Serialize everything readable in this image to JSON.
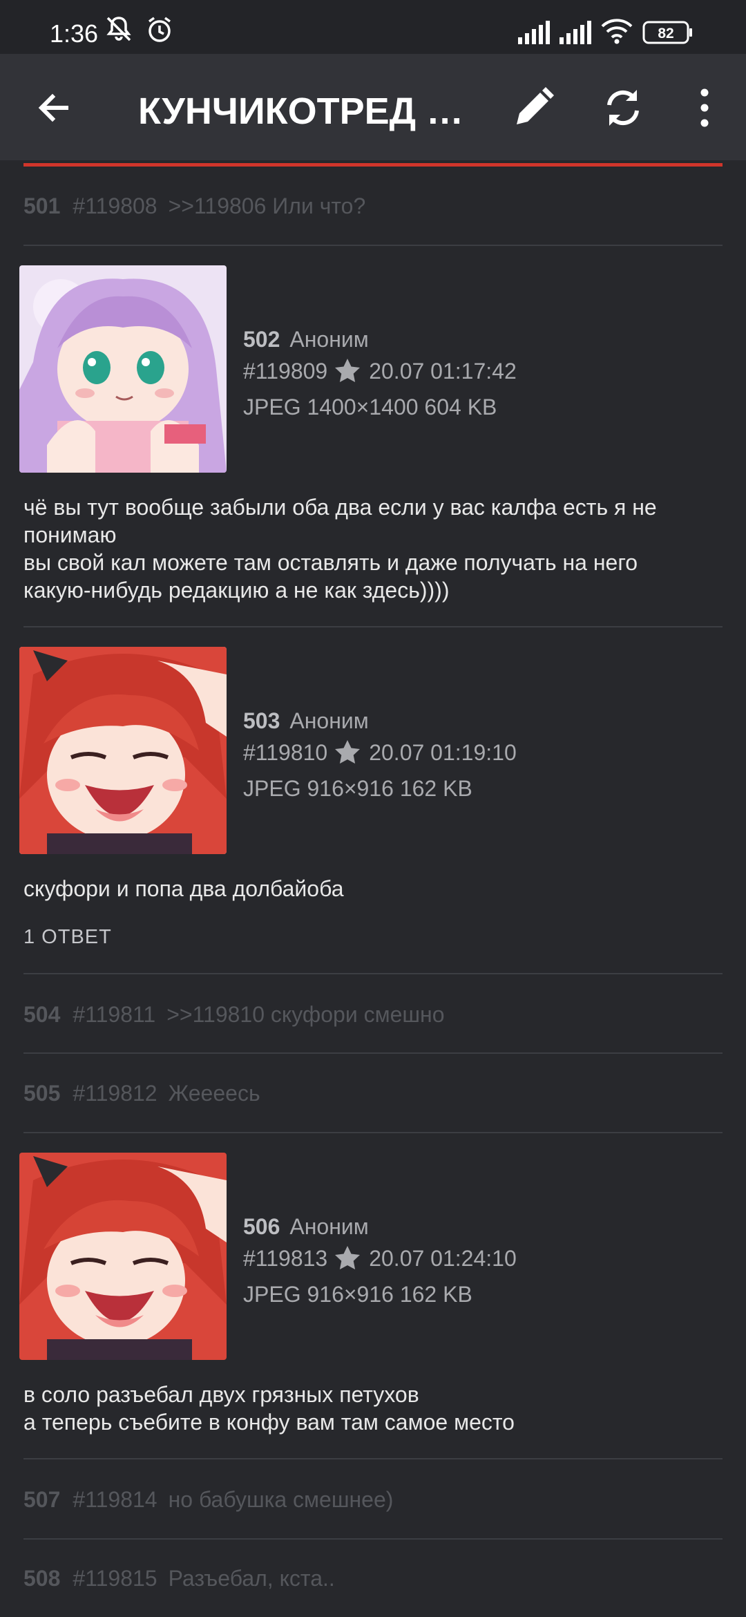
{
  "status_bar": {
    "time": "1:36",
    "battery": "82"
  },
  "toolbar": {
    "title": "КУНЧИКОТРЕД №…",
    "back_icon": "arrow-left",
    "edit_icon": "pencil",
    "refresh_icon": "refresh",
    "menu_icon": "dots-vertical"
  },
  "colors": {
    "background": "#27282c",
    "toolbar": "#323338",
    "accent": "#d0352b"
  },
  "posts": [
    {
      "num": "501",
      "id": "#119808",
      "preview": ">>119806 Или что?"
    },
    {
      "num": "502",
      "author": "Аноним",
      "id": "#119809",
      "date": "20.07 01:17:42",
      "file": "JPEG 1400×1400 604 KB",
      "text_lines": [
        "чё вы тут вообще забыли оба два если у вас калфа есть я не",
        "понимаю",
        "вы свой кал можете там оставлять и даже получать на него",
        "какую-нибудь редакцию а не как здесь))))"
      ]
    },
    {
      "num": "503",
      "author": "Аноним",
      "id": "#119810",
      "date": "20.07 01:19:10",
      "file": "JPEG 916×916 162 KB",
      "text_lines": [
        "скуфори и попа два долбайоба"
      ],
      "replies": "1 ОТВЕТ"
    },
    {
      "num": "504",
      "id": "#119811",
      "preview": ">>119810 скуфори смешно"
    },
    {
      "num": "505",
      "id": "#119812",
      "preview": "Жеееесь"
    },
    {
      "num": "506",
      "author": "Аноним",
      "id": "#119813",
      "date": "20.07 01:24:10",
      "file": "JPEG 916×916 162 KB",
      "text_lines": [
        "в соло разъебал двух грязных петухов",
        "а теперь съебите в конфу вам там самое место"
      ]
    },
    {
      "num": "507",
      "id": "#119814",
      "preview": "но бабушка смешнее)"
    },
    {
      "num": "508",
      "id": "#119815",
      "preview": "Разъебал, кста.."
    }
  ]
}
